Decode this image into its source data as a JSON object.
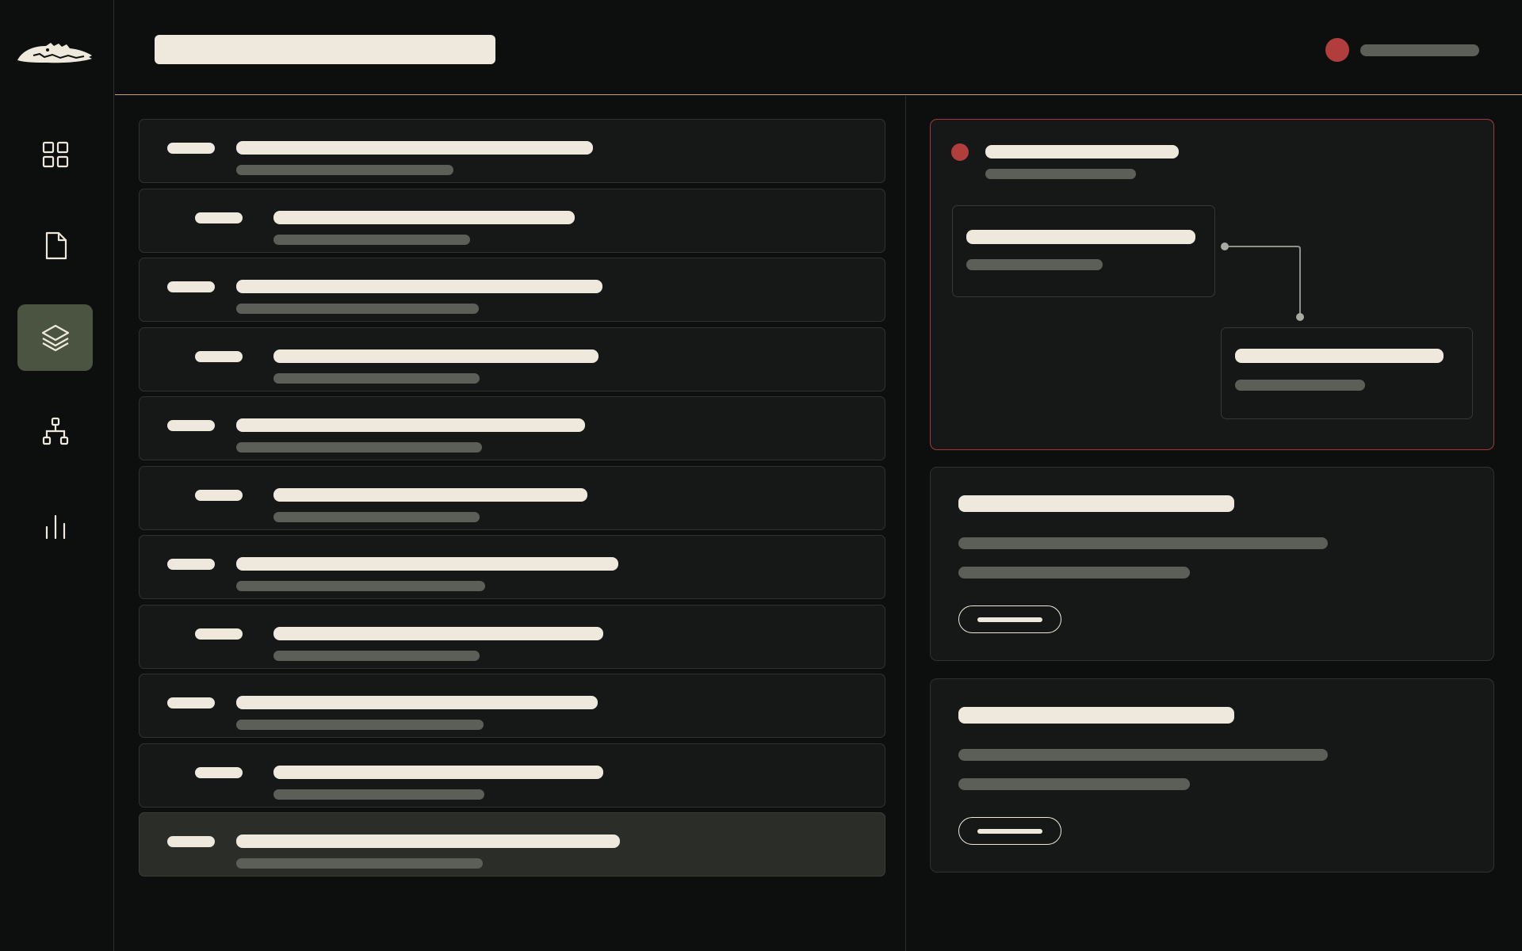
{
  "window": {
    "title": ""
  },
  "header": {
    "search": {
      "value": "",
      "placeholder": ""
    },
    "user": {
      "name": ""
    }
  },
  "sidebar": {
    "items": [
      {
        "icon": "grid-icon"
      },
      {
        "icon": "document-icon"
      },
      {
        "icon": "layers-icon",
        "active": true
      },
      {
        "icon": "hierarchy-icon"
      },
      {
        "icon": "bar-chart-icon"
      }
    ]
  },
  "list": {
    "rows": [
      {
        "tag": "",
        "title": "",
        "subtitle": ""
      },
      {
        "tag": "",
        "title": "",
        "subtitle": ""
      },
      {
        "tag": "",
        "title": "",
        "subtitle": ""
      },
      {
        "tag": "",
        "title": "",
        "subtitle": ""
      },
      {
        "tag": "",
        "title": "",
        "subtitle": ""
      },
      {
        "tag": "",
        "title": "",
        "subtitle": ""
      },
      {
        "tag": "",
        "title": "",
        "subtitle": ""
      },
      {
        "tag": "",
        "title": "",
        "subtitle": ""
      },
      {
        "tag": "",
        "title": "",
        "subtitle": ""
      },
      {
        "tag": "",
        "title": "",
        "subtitle": ""
      },
      {
        "tag": "",
        "title": "",
        "subtitle": "",
        "selected": true
      }
    ]
  },
  "detail": {
    "flow_card": {
      "title": "",
      "subtitle": "",
      "source_node": {
        "title": "",
        "subtitle": ""
      },
      "target_node": {
        "title": "",
        "subtitle": ""
      }
    },
    "cards": [
      {
        "title": "",
        "line1": "",
        "line2": "",
        "button": ""
      },
      {
        "title": "",
        "line1": "",
        "line2": "",
        "button": ""
      }
    ]
  },
  "colors": {
    "background": "#0d0f0e",
    "panel": "#151816",
    "text_light": "#efe9dd",
    "text_dim": "#5c5e58",
    "accent_red": "#b13e3c",
    "accent_active": "#4a5440",
    "header_rule": "#c9a27a"
  }
}
